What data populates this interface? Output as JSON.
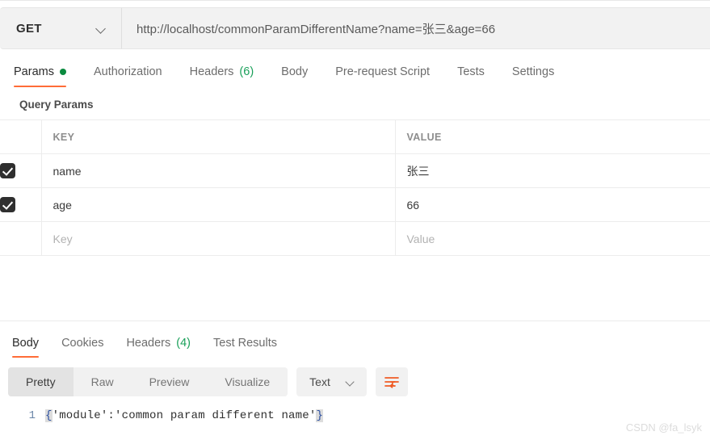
{
  "request": {
    "method": "GET",
    "url": "http://localhost/commonParamDifferentName?name=张三&age=66",
    "tabs": [
      {
        "label": "Params",
        "badge": "",
        "dot": true,
        "active": true
      },
      {
        "label": "Authorization",
        "badge": "",
        "dot": false,
        "active": false
      },
      {
        "label": "Headers",
        "badge": "(6)",
        "dot": false,
        "active": false
      },
      {
        "label": "Body",
        "badge": "",
        "dot": false,
        "active": false
      },
      {
        "label": "Pre-request Script",
        "badge": "",
        "dot": false,
        "active": false
      },
      {
        "label": "Tests",
        "badge": "",
        "dot": false,
        "active": false
      },
      {
        "label": "Settings",
        "badge": "",
        "dot": false,
        "active": false
      }
    ]
  },
  "query_params": {
    "title": "Query Params",
    "headers": {
      "key": "KEY",
      "value": "VALUE"
    },
    "rows": [
      {
        "checked": true,
        "key": "name",
        "value": "张三"
      },
      {
        "checked": true,
        "key": "age",
        "value": "66"
      }
    ],
    "new_row": {
      "checked": false,
      "key_placeholder": "Key",
      "value_placeholder": "Value"
    }
  },
  "response": {
    "tabs": [
      {
        "label": "Body",
        "badge": "",
        "active": true
      },
      {
        "label": "Cookies",
        "badge": "",
        "active": false
      },
      {
        "label": "Headers",
        "badge": "(4)",
        "active": false
      },
      {
        "label": "Test Results",
        "badge": "",
        "active": false
      }
    ],
    "view_modes": [
      {
        "label": "Pretty",
        "active": true
      },
      {
        "label": "Raw",
        "active": false
      },
      {
        "label": "Preview",
        "active": false
      },
      {
        "label": "Visualize",
        "active": false
      }
    ],
    "format": "Text",
    "body": {
      "line_number": "1",
      "open_brace": "{",
      "content": "'module':'common param different name'",
      "close_brace": "}"
    }
  },
  "watermark": "CSDN @fa_lsyk",
  "colors": {
    "accent": "#ff6c37",
    "badge_green": "#1aa05a",
    "dot_green": "#0a8a3f"
  }
}
